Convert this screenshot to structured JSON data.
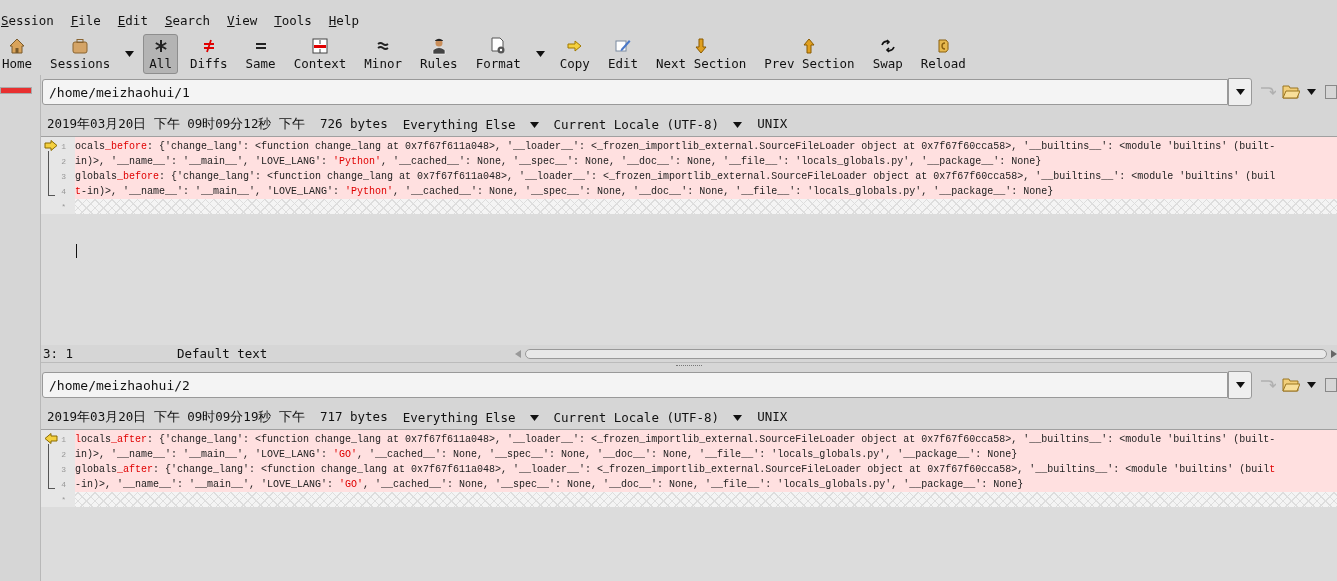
{
  "menu": [
    "Session",
    "File",
    "Edit",
    "Search",
    "View",
    "Tools",
    "Help"
  ],
  "toolbar": [
    {
      "label": "Home",
      "selected": false,
      "has_menu": false
    },
    {
      "label": "Sessions",
      "selected": false,
      "has_menu": true
    },
    {
      "label": "All",
      "selected": true,
      "has_menu": false
    },
    {
      "label": "Diffs",
      "selected": false,
      "has_menu": false
    },
    {
      "label": "Same",
      "selected": false,
      "has_menu": false
    },
    {
      "label": "Context",
      "selected": false,
      "has_menu": false
    },
    {
      "label": "Minor",
      "selected": false,
      "has_menu": false
    },
    {
      "label": "Rules",
      "selected": false,
      "has_menu": false
    },
    {
      "label": "Format",
      "selected": false,
      "has_menu": true
    },
    {
      "label": "Copy",
      "selected": false,
      "has_menu": false
    },
    {
      "label": "Edit",
      "selected": false,
      "has_menu": false
    },
    {
      "label": "Next Section",
      "selected": false,
      "has_menu": false
    },
    {
      "label": "Prev Section",
      "selected": false,
      "has_menu": false
    },
    {
      "label": "Swap",
      "selected": false,
      "has_menu": false
    },
    {
      "label": "Reload",
      "selected": false,
      "has_menu": false
    }
  ],
  "panes": [
    {
      "path": "/home/meizhaohui/1",
      "timestamp": "2019年03月20日 下午 09时09分12秒 下午",
      "size": "726 bytes",
      "format": "Everything Else",
      "encoding": "Current Locale (UTF-8)",
      "line_ending": "UNIX",
      "kind": "right",
      "cursor": true,
      "lines": [
        {
          "number": "1",
          "segments": [
            {
              "text": "ocals",
              "changed": false
            },
            {
              "text": "_before",
              "changed": true
            },
            {
              "text": ": {'change_lang': <function change_lang at 0x7f67f611a048>, '__loader__': <_frozen_importlib_external.SourceFileLoader object at 0x7f67f60cca58>, '__builtins__': <module 'builtins' (built-",
              "changed": false
            }
          ]
        },
        {
          "number": "2",
          "segments": [
            {
              "text": "in)>, '__name__': '__main__', 'LOVE_LANG': ",
              "changed": false
            },
            {
              "text": "'Python'",
              "changed": true
            },
            {
              "text": ", '__cached__': None, '__spec__': None, '__doc__': None, '__file__': 'locals_globals.py', '__package__': None}",
              "changed": false
            }
          ]
        },
        {
          "number": "3",
          "segments": [
            {
              "text": "globals",
              "changed": false
            },
            {
              "text": "_before",
              "changed": true
            },
            {
              "text": ": {'change_lang': <function change_lang at 0x7f67f611a048>, '__loader__': <_frozen_importlib_external.SourceFileLoader object at 0x7f67f60cca58>, '__builtins__': <module 'builtins' (buil",
              "changed": false
            }
          ]
        },
        {
          "number": "4",
          "segments": [
            {
              "text": "t",
              "changed": true
            },
            {
              "text": "-in)>, '__name__': '__main__', 'LOVE_LANG': ",
              "changed": false
            },
            {
              "text": "'Python'",
              "changed": true
            },
            {
              "text": ", '__cached__': None, '__spec__': None, '__doc__': None, '__file__': 'locals_globals.py', '__package__': None}",
              "changed": false
            }
          ]
        }
      ],
      "empty_mark": "*",
      "status_bar": {
        "position": "3: 1",
        "syntax": "Default text"
      }
    },
    {
      "path": "/home/meizhaohui/2",
      "timestamp": "2019年03月20日 下午 09时09分19秒 下午",
      "size": "717 bytes",
      "format": "Everything Else",
      "encoding": "Current Locale (UTF-8)",
      "line_ending": "UNIX",
      "kind": "left",
      "cursor": false,
      "lines": [
        {
          "number": "1",
          "segments": [
            {
              "text": "l",
              "changed": true
            },
            {
              "text": "ocals",
              "changed": false
            },
            {
              "text": "_after",
              "changed": true
            },
            {
              "text": ": {'change_lang': <function change_lang at 0x7f67f611a048>, '__loader__': <_frozen_importlib_external.SourceFileLoader object at 0x7f67f60cca58>, '__builtins__': <module 'builtins' (built-",
              "changed": false
            }
          ]
        },
        {
          "number": "2",
          "segments": [
            {
              "text": "in)>, '__name__': '__main__', 'LOVE_LANG': ",
              "changed": false
            },
            {
              "text": "'GO'",
              "changed": true
            },
            {
              "text": ", '__cached__': None, '__spec__': None, '__doc__': None, '__file__': 'locals_globals.py', '__package__': None}",
              "changed": false
            }
          ]
        },
        {
          "number": "3",
          "segments": [
            {
              "text": "globals",
              "changed": false
            },
            {
              "text": "_after",
              "changed": true
            },
            {
              "text": ": {'change_lang': <function change_lang at 0x7f67f611a048>, '__loader__': <_frozen_importlib_external.SourceFileLoader object at 0x7f67f60cca58>, '__builtins__': <module 'builtins' (buil",
              "changed": false
            },
            {
              "text": "t",
              "changed": true
            }
          ]
        },
        {
          "number": "4",
          "segments": [
            {
              "text": "-in)>, '__name__': '__main__', 'LOVE_LANG': ",
              "changed": false
            },
            {
              "text": "'GO'",
              "changed": true
            },
            {
              "text": ", '__cached__': None, '__spec__': None, '__doc__': None, '__file__': 'locals_globals.py', '__package__': None}",
              "changed": false
            }
          ]
        }
      ],
      "empty_mark": "*"
    }
  ]
}
